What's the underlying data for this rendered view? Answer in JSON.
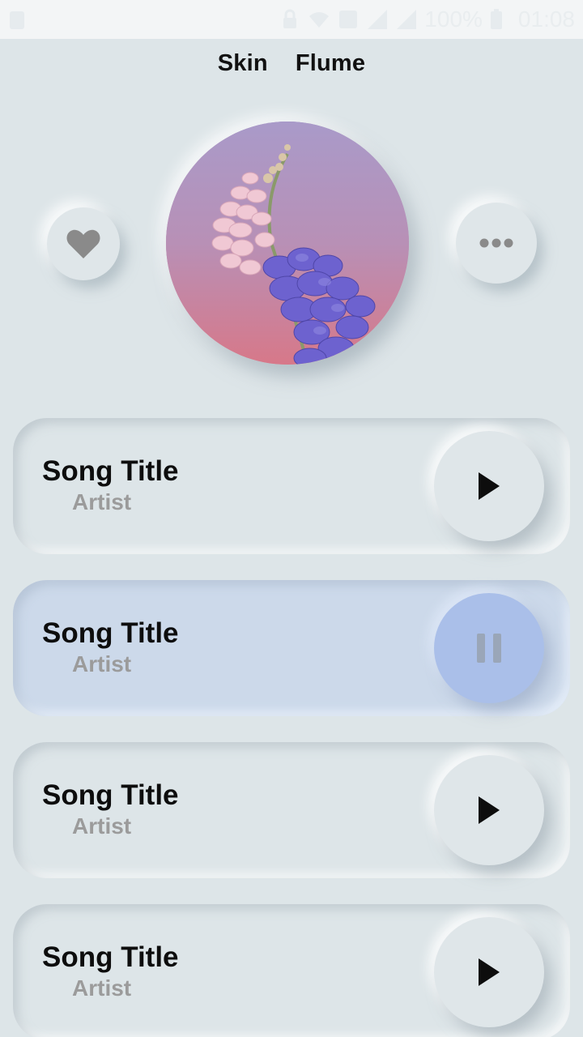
{
  "status_bar": {
    "battery": "100%",
    "time": "01:08"
  },
  "header": {
    "title_left": "Skin",
    "title_right": "Flume"
  },
  "controls": {
    "favorite_icon": "heart-icon",
    "more_icon": "more-dots-icon"
  },
  "colors": {
    "background": "#dde5e8",
    "active_row": "#ccd9ea",
    "active_button": "#aabfe9",
    "artist_text": "#9b9b9b"
  },
  "songs": [
    {
      "title": "Song Title",
      "artist": "Artist",
      "state": "paused",
      "icon": "play-icon"
    },
    {
      "title": "Song Title",
      "artist": "Artist",
      "state": "playing",
      "icon": "pause-icon"
    },
    {
      "title": "Song Title",
      "artist": "Artist",
      "state": "paused",
      "icon": "play-icon"
    },
    {
      "title": "Song Title",
      "artist": "Artist",
      "state": "paused",
      "icon": "play-icon"
    }
  ]
}
